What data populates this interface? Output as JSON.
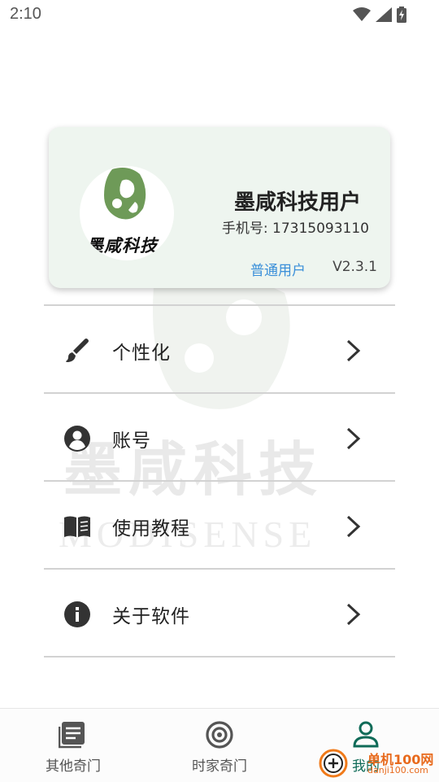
{
  "status_bar": {
    "time": "2:10"
  },
  "watermark": {
    "text": "墨咸科技",
    "sub": "MODISENSE"
  },
  "profile": {
    "avatar_caption": "墨咸科技",
    "name": "墨咸科技用户",
    "phone": "手机号: 17315093110",
    "user_type": "普通用户",
    "version": "V2.3.1"
  },
  "menu": {
    "items": [
      {
        "label": "个性化",
        "icon": "brush-icon"
      },
      {
        "label": "账号",
        "icon": "account-circle-icon"
      },
      {
        "label": "使用教程",
        "icon": "book-icon"
      },
      {
        "label": "关于软件",
        "icon": "info-icon"
      }
    ]
  },
  "bottom_nav": {
    "items": [
      {
        "label": "其他奇门",
        "icon": "article-icon"
      },
      {
        "label": "时家奇门",
        "icon": "target-icon"
      },
      {
        "label": "我的",
        "icon": "person-icon"
      }
    ]
  },
  "corner_logo": {
    "text": "单机100网",
    "url_text": "danji100.com"
  },
  "colors": {
    "accent": "#0f6b58",
    "card_bg": "#eef5ef",
    "link_blue": "#3a8fd9",
    "logo_green": "#6e9a58"
  }
}
